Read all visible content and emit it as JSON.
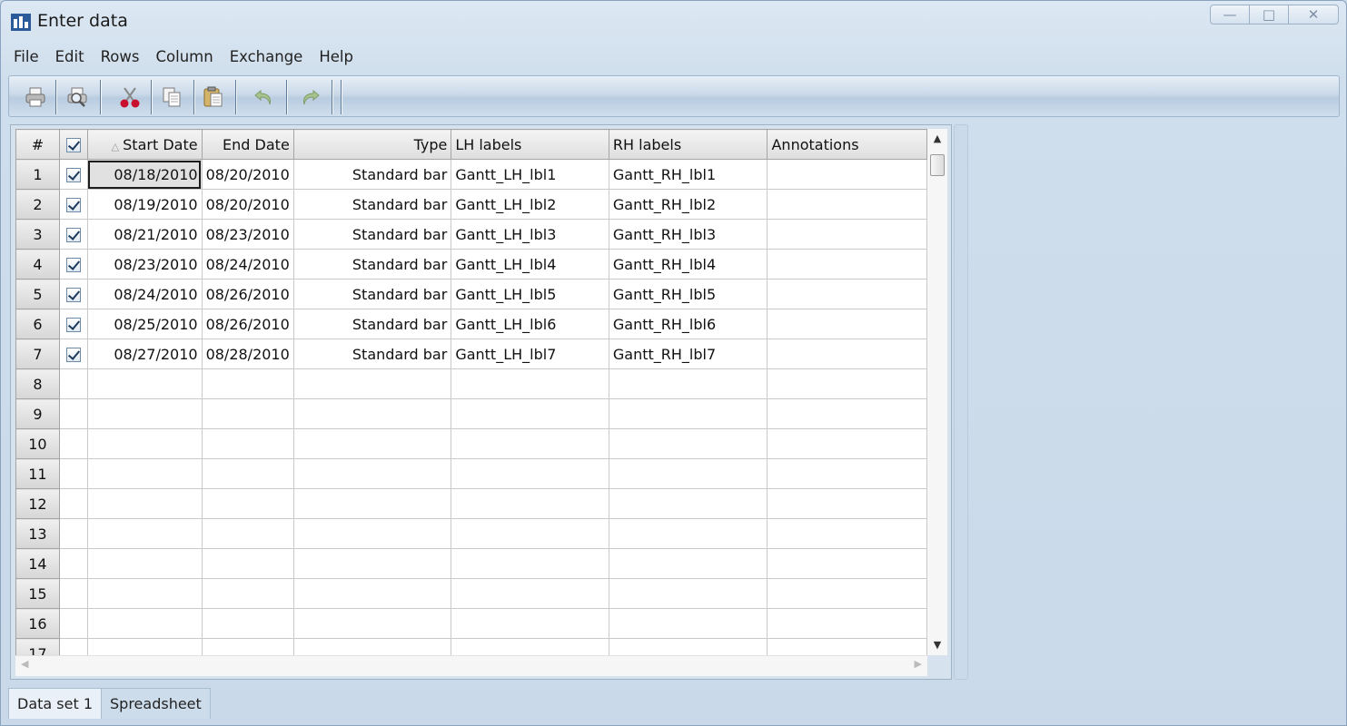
{
  "window": {
    "title": "Enter data",
    "controls": {
      "minimize": "—",
      "maximize": "□",
      "close": "✕"
    }
  },
  "menu": [
    "File",
    "Edit",
    "Rows",
    "Column",
    "Exchange",
    "Help"
  ],
  "toolbar": {
    "buttons": [
      "print-icon",
      "print-preview-icon",
      "cut-icon",
      "copy-icon",
      "paste-icon",
      "undo-icon",
      "redo-icon"
    ]
  },
  "grid": {
    "columns": {
      "num": "#",
      "start_date": "Start Date",
      "end_date": "End Date",
      "type": "Type",
      "lh_labels": "LH labels",
      "rh_labels": "RH labels",
      "annotations": "Annotations"
    },
    "sort_indicator": "△",
    "rows": [
      {
        "num": "1",
        "checked": true,
        "start": "08/18/2010",
        "end": "08/20/2010",
        "type": "Standard bar",
        "lh": "Gantt_LH_lbl1",
        "rh": "Gantt_RH_lbl1",
        "ann": ""
      },
      {
        "num": "2",
        "checked": true,
        "start": "08/19/2010",
        "end": "08/20/2010",
        "type": "Standard bar",
        "lh": "Gantt_LH_lbl2",
        "rh": "Gantt_RH_lbl2",
        "ann": ""
      },
      {
        "num": "3",
        "checked": true,
        "start": "08/21/2010",
        "end": "08/23/2010",
        "type": "Standard bar",
        "lh": "Gantt_LH_lbl3",
        "rh": "Gantt_RH_lbl3",
        "ann": ""
      },
      {
        "num": "4",
        "checked": true,
        "start": "08/23/2010",
        "end": "08/24/2010",
        "type": "Standard bar",
        "lh": "Gantt_LH_lbl4",
        "rh": "Gantt_RH_lbl4",
        "ann": ""
      },
      {
        "num": "5",
        "checked": true,
        "start": "08/24/2010",
        "end": "08/26/2010",
        "type": "Standard bar",
        "lh": "Gantt_LH_lbl5",
        "rh": "Gantt_RH_lbl5",
        "ann": ""
      },
      {
        "num": "6",
        "checked": true,
        "start": "08/25/2010",
        "end": "08/26/2010",
        "type": "Standard bar",
        "lh": "Gantt_LH_lbl6",
        "rh": "Gantt_RH_lbl6",
        "ann": ""
      },
      {
        "num": "7",
        "checked": true,
        "start": "08/27/2010",
        "end": "08/28/2010",
        "type": "Standard bar",
        "lh": "Gantt_LH_lbl7",
        "rh": "Gantt_RH_lbl7",
        "ann": ""
      },
      {
        "num": "8",
        "checked": false,
        "start": "",
        "end": "",
        "type": "",
        "lh": "",
        "rh": "",
        "ann": ""
      },
      {
        "num": "9",
        "checked": false,
        "start": "",
        "end": "",
        "type": "",
        "lh": "",
        "rh": "",
        "ann": ""
      },
      {
        "num": "10",
        "checked": false,
        "start": "",
        "end": "",
        "type": "",
        "lh": "",
        "rh": "",
        "ann": ""
      },
      {
        "num": "11",
        "checked": false,
        "start": "",
        "end": "",
        "type": "",
        "lh": "",
        "rh": "",
        "ann": ""
      },
      {
        "num": "12",
        "checked": false,
        "start": "",
        "end": "",
        "type": "",
        "lh": "",
        "rh": "",
        "ann": ""
      },
      {
        "num": "13",
        "checked": false,
        "start": "",
        "end": "",
        "type": "",
        "lh": "",
        "rh": "",
        "ann": ""
      },
      {
        "num": "14",
        "checked": false,
        "start": "",
        "end": "",
        "type": "",
        "lh": "",
        "rh": "",
        "ann": ""
      },
      {
        "num": "15",
        "checked": false,
        "start": "",
        "end": "",
        "type": "",
        "lh": "",
        "rh": "",
        "ann": ""
      },
      {
        "num": "16",
        "checked": false,
        "start": "",
        "end": "",
        "type": "",
        "lh": "",
        "rh": "",
        "ann": ""
      },
      {
        "num": "17",
        "checked": false,
        "start": "",
        "end": "",
        "type": "",
        "lh": "",
        "rh": "",
        "ann": ""
      }
    ]
  },
  "sheet_tabs": [
    {
      "label": "Data set 1",
      "active": true
    },
    {
      "label": "Spreadsheet",
      "active": false
    }
  ],
  "colors": {
    "cut_icon": "#c8102e",
    "undo_redo_disabled": "#9fb98a",
    "accent": "#2a5a9a"
  }
}
